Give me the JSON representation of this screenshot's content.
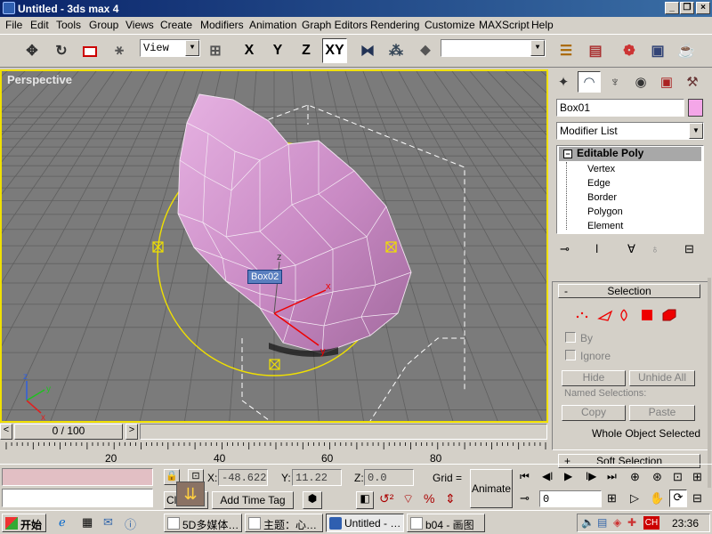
{
  "window": {
    "title": "Untitled - 3ds max 4",
    "minimize": "_",
    "restore": "❐",
    "close": "×"
  },
  "menu": [
    "File",
    "Edit",
    "Tools",
    "Group",
    "Views",
    "Create",
    "Modifiers",
    "Animation",
    "Graph Editors",
    "Rendering",
    "Customize",
    "MAXScript",
    "Help"
  ],
  "toolbar": {
    "coord_system": "View",
    "axis_x": "X",
    "axis_y": "Y",
    "axis_z": "Z",
    "axis_xy": "XY",
    "named_selection": ""
  },
  "viewport": {
    "label": "Perspective",
    "object_tag": "Box02",
    "axis_labels": {
      "x": "x",
      "y": "y",
      "z": "z"
    },
    "colors": {
      "background": "#7b7b7b",
      "grid": "#5f5f5f",
      "object": "#d79ad3",
      "selection": "#f0e000",
      "highlight_border": "#f0e000"
    }
  },
  "command_panel": {
    "object_name": "Box01",
    "object_color": "#f4a6e8",
    "modifier_list": "Modifier List",
    "stack": {
      "top": "Editable Poly",
      "expand": "−",
      "subobjects": [
        "Vertex",
        "Edge",
        "Border",
        "Polygon",
        "Element"
      ]
    },
    "selection": {
      "title": "Selection",
      "collapse": "-",
      "by_vertex": "By",
      "ignore_backfacing": "Ignore",
      "hide": "Hide",
      "unhide_all": "Unhide All",
      "named_selections": "Named Selections:",
      "copy": "Copy",
      "paste": "Paste",
      "status": "Whole Object Selected"
    },
    "soft_selection": {
      "title": "Soft Selection",
      "expand": "+"
    }
  },
  "time_slider": {
    "frame": "0 / 100",
    "prev": "<",
    "next": ">",
    "ticks": [
      "20",
      "40",
      "60",
      "80"
    ]
  },
  "status_bar": {
    "x_label": "X:",
    "x_value": "-48.622",
    "y_label": "Y:",
    "y_value": "11.22",
    "z_label": "Z:",
    "z_value": "0.0",
    "grid_label": "Grid =",
    "animate": "Animate",
    "prompt": "Click",
    "add_time_tag": "Add Time Tag",
    "current_frame": "0"
  },
  "taskbar": {
    "start": "开始",
    "tasks": [
      {
        "label": "5D多媒体…",
        "active": false
      },
      {
        "label": "主题：心…",
        "active": false
      },
      {
        "label": "Untitled - …",
        "active": true
      },
      {
        "label": "b04 - 画图",
        "active": false
      }
    ],
    "ime": "CH",
    "clock": "23:36"
  }
}
